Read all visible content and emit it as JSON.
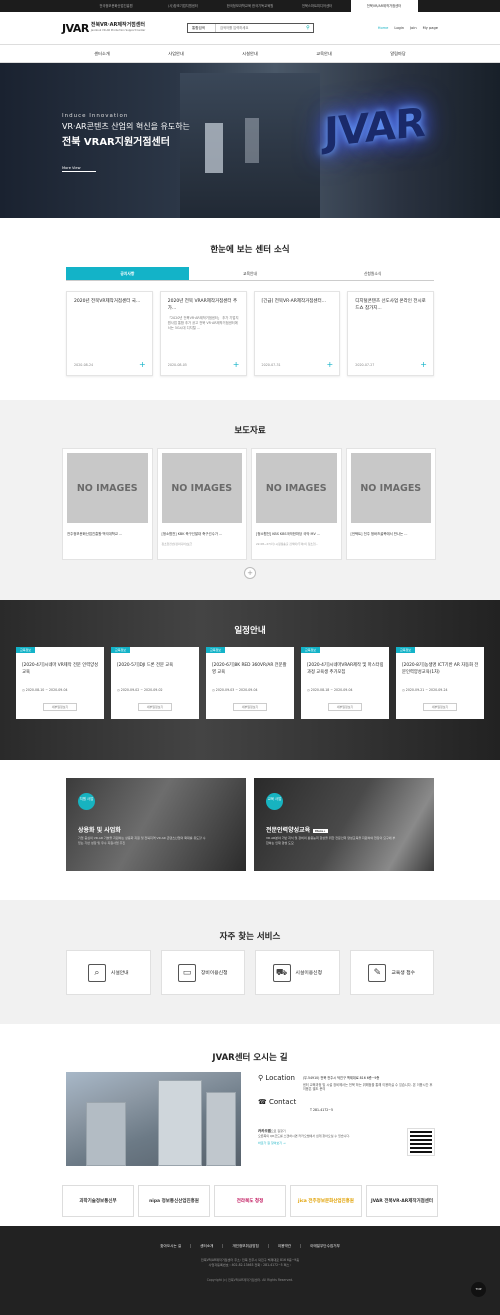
{
  "topbar": [
    "전국정보문화산업진흥원",
    "(사)창조기업지원센터",
    "한국정보과학교육 한국기독교육원",
    "전북스마트미디어센터",
    "전북VR/AR제작거점센터"
  ],
  "header": {
    "logo_mark": "JVAR",
    "logo_title": "전북VR·AR제작거점센터",
    "logo_sub": "Jeonbuk VR·AR Production Support Center",
    "search_select": "통합검색",
    "search_placeholder": "검색어를 입력하세요",
    "util": [
      "Home",
      "Login",
      "Join",
      "My page"
    ]
  },
  "gnb": [
    "센터소개",
    "사업안내",
    "시설안내",
    "교육안내",
    "알림마당"
  ],
  "hero": {
    "en": "Induce Innovation",
    "line1": "VR·AR콘텐츠 산업의 혁신을 유도하는",
    "line2": "전북 VRAR지원거점센터",
    "more": "More View",
    "sign": "JVAR"
  },
  "news": {
    "title": "한눈에 보는 센터 소식",
    "tabs": [
      "공지사항",
      "교육안내",
      "신청원소식"
    ],
    "cards": [
      {
        "title": "2020년 전북VR제작거점센터 국...",
        "desc": "",
        "date": "2020-08-24"
      },
      {
        "title": "2020년 전북 VRAR제작거점센터 추가...",
        "desc": "「2020년 전북VR·AR제작거점센터」 추가 기업지원사업 통합 추가 공고 전북 VR·AR제작거점센터에서는 5G시대 디지털 ...",
        "date": "2020-08-05"
      },
      {
        "title": "[긴급] 전북VR·AR제작거점센터...",
        "desc": "",
        "date": "2020-07-31"
      },
      {
        "title": "디지털콘텐츠 선도사업 온라인 전시로드쇼 참가지...",
        "desc": "",
        "date": "2020-07-27"
      }
    ]
  },
  "press": {
    "title": "보도자료",
    "noimg": "NO IMAGES",
    "cards": [
      {
        "title": "전주정보문화산업진흥원·백석대학교 ...",
        "src": ""
      },
      {
        "title": "[청소협전] KBK 축구선발대 축구선수가 ...",
        "src": "청소협전[실감미디어]보급"
      },
      {
        "title": "[청소협전] KBS KBS국악한마당 국악 MV ...",
        "src": "22.08~27(더) 시청점송출 검색이(두이)이 청소협..."
      },
      {
        "title": "[언택트] 전주 청바즈골목에서 만나는 ...",
        "src": ""
      }
    ],
    "more": "+"
  },
  "schedule": {
    "title": "일정안내",
    "tag": "교육정보",
    "btn": "세부일정보기",
    "cards": [
      {
        "title": "[2020-4기]시네마 VR제작 전문 인력양성교육",
        "date": "2020-08-10 ~ 2020-09-04"
      },
      {
        "title": "[2020-5기]DJI 드론 전문 교육",
        "date": "2020-09-02 ~ 2020-09-02"
      },
      {
        "title": "[2020-6기]8K RED 360VR/AR 전문촬영 교육",
        "date": "2020-09-03 ~ 2020-09-04"
      },
      {
        "title": "[2020-4기]시네마VRAR제작 및 마스터링 과정 교육생 추가모집",
        "date": "2020-08-18 ~ 2020-09-04"
      },
      {
        "title": "[2020-8기]농생명 ICT기반 AR 자동화 전문인력양성교육(1차)",
        "date": "2020-09-21 ~ 2020-09-24"
      }
    ]
  },
  "promo": [
    {
      "badge": "지원 사업",
      "title": "상용화 및 사업화",
      "more": "",
      "desc": "기업 중심의 VR·AR 기술을 지원하는 상용화 지원 및 전북지역 VR·AR 콘텐츠산업의 확대를 유도할 수 있는 기반 성장 및 우수 지원사업 추진"
    },
    {
      "badge": "교육 사업",
      "title": "전문인력양성교육",
      "more": "More+",
      "desc": "VR·AR분야 기반 지식 및 장비의 활용능력 향상을 위한 전문인력 양성교육을 지원하여 현장의 요구에 부합하는 인재 양성 도모"
    }
  ],
  "services": {
    "title": "자주 찾는 서비스",
    "items": [
      {
        "label": "시설안내",
        "icon": "building-search-icon"
      },
      {
        "label": "장비이용신청",
        "icon": "monitor-equipment-icon"
      },
      {
        "label": "시설이용신청",
        "icon": "truck-facility-icon"
      },
      {
        "label": "교육생 접수",
        "icon": "education-signup-icon"
      }
    ]
  },
  "visit": {
    "title": "JVAR센터 오시는 길",
    "loc_label": "Location",
    "loc_addr": "(우.54910) 전북 전주시 덕진구 백제대로 816 6층~9층",
    "loc_desc": "센터 교육과정 및 시설 장비에서는 전북 하는 위해점을 통해 이용하실 수 있습니다. 본 이용시간 후 이용은 별도 문의",
    "contact_label": "Contact",
    "contact_tel": "T  281-4172~5",
    "kakao_title": "카카오맵",
    "kakao_sub": "으로 길찾기",
    "kakao_desc": "오른쪽의 QR코드를 스캔하시면 카카오맵에서 쉽게 찾아오실 수 있습니다.",
    "kakao_link": "바로가 길 찾아보기 →"
  },
  "partners": [
    "과학기술정보통신부",
    "nipa 정보통신산업진흥원",
    "전라북도 청정",
    "jica 전주정보문화산업진흥원",
    "JVAR 전북VR·AR제작거점센터"
  ],
  "footer": {
    "links": [
      "찾아오시는 길",
      "센터소개",
      "개인정보취급방침",
      "이용약관",
      "이메일무단수집거부"
    ],
    "addr1": "전북VR/AR제작거점센터  주소: 전북 전주시 덕진구 백제대로 816 6층~9층",
    "addr2": "사업자등록번호 : 402-82-13463    전화 : 281-4172~5    팩스 :",
    "copy": "Copyright (c) 전북VR/AR제작거점센터. All Rights Reserved."
  },
  "top_btn": "TOP"
}
